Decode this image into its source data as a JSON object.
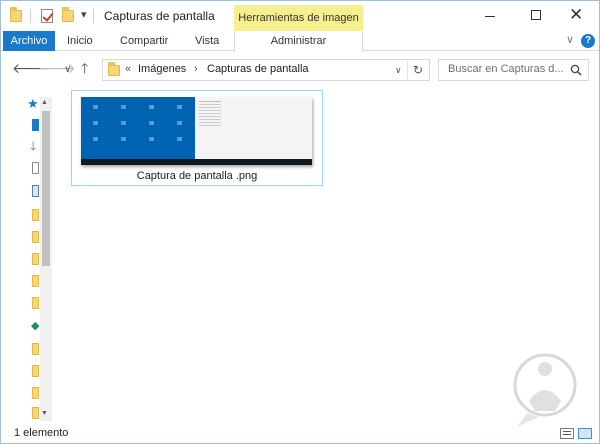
{
  "window": {
    "title": "Capturas de pantalla",
    "context_tab_label": "Herramientas de imagen"
  },
  "ribbon": {
    "tabs": [
      {
        "label": "Archivo"
      },
      {
        "label": "Inicio"
      },
      {
        "label": "Compartir"
      },
      {
        "label": "Vista"
      },
      {
        "label": "Administrar"
      }
    ]
  },
  "nav": {
    "breadcrumb_overflow": "«",
    "breadcrumbs": [
      {
        "label": "Imágenes"
      },
      {
        "label": "Capturas de pantalla"
      }
    ],
    "search_placeholder": "Buscar en Capturas d..."
  },
  "content": {
    "items": [
      {
        "label": "Captura de pantalla .png",
        "selected": true
      }
    ]
  },
  "status": {
    "item_count": "1 elemento"
  },
  "icons": {
    "back": "arrow-left-icon",
    "forward": "arrow-right-icon",
    "recent": "chevron-down-icon",
    "up": "arrow-up-icon",
    "refresh": "refresh-icon",
    "search": "search-icon"
  },
  "colors": {
    "accent": "#1979ca",
    "context_tab": "#f6ef8f",
    "selection_border": "#99d1ff",
    "thumbnail_desktop": "#0063b1"
  }
}
